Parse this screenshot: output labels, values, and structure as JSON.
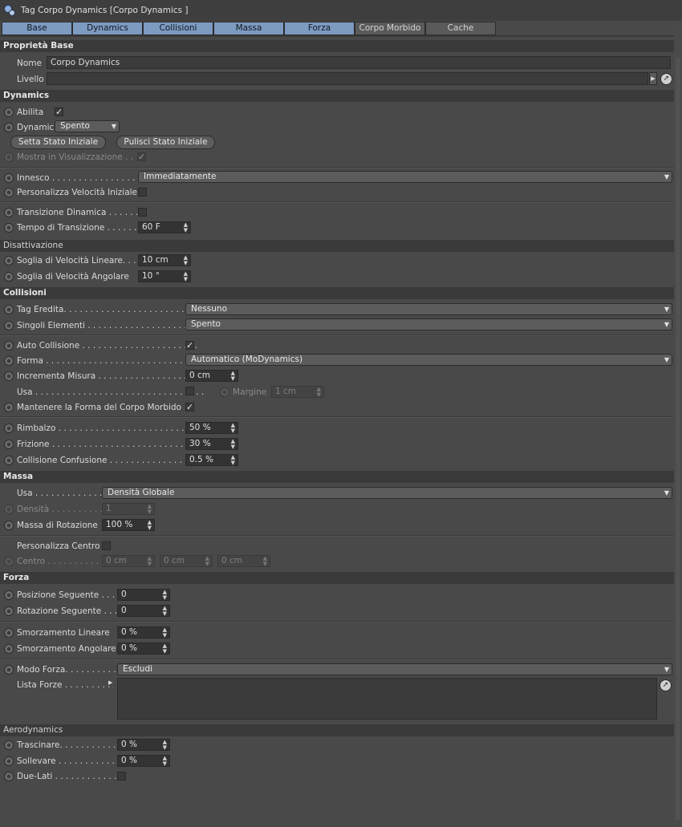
{
  "window": {
    "title": "Tag Corpo Dynamics [Corpo Dynamics ]"
  },
  "tabs": [
    {
      "label": "Base",
      "active": true
    },
    {
      "label": "Dynamics",
      "active": true
    },
    {
      "label": "Collisioni",
      "active": true
    },
    {
      "label": "Massa",
      "active": true
    },
    {
      "label": "Forza",
      "active": true
    },
    {
      "label": "Corpo Morbido",
      "active": false
    },
    {
      "label": "Cache",
      "active": false
    }
  ],
  "base": {
    "header": "Proprietà Base",
    "name_label": "Nome",
    "name_value": "Corpo Dynamics",
    "layer_label": "Livello",
    "layer_value": ""
  },
  "dynamics": {
    "header": "Dynamics",
    "enable_label": "Abilita",
    "enable_checked": "✓",
    "dynamic_label": "Dynamic",
    "dynamic_value": "Spento",
    "set_initial_button": "Setta Stato Iniziale",
    "clear_initial_button": "Pulisci Stato Iniziale",
    "show_in_view_label": "Mostra in Visualizzazione . .",
    "show_in_view_checked": "✓",
    "trigger_label": "Innesco . . . . . . . . . . . . . . . . . . .",
    "trigger_value": "Immediatamente",
    "custom_velocity_label": "Personalizza Velocità Iniziale",
    "dynamic_transition_label": "Transizione Dinamica . . . . . .",
    "transition_time_label": "Tempo di Transizione . . . . . .",
    "transition_time_value": "60 F"
  },
  "deactivation": {
    "header": "Disattivazione",
    "linear_threshold_label": "Soglia di Velocità Lineare. . .",
    "linear_threshold_value": "10 cm",
    "angular_threshold_label": "Soglia di Velocità Angolare",
    "angular_threshold_value": "10 °"
  },
  "collisions": {
    "header": "Collisioni",
    "inherit_tag_label": "Tag Eredita. . . . . . . . . . . . . . . . . . . . . . . . . .",
    "inherit_tag_value": "Nessuno",
    "individual_elements_label": "Singoli Elementi . . . . . . . . . . . . . . . . . . . . .",
    "individual_elements_value": "Spento",
    "self_collision_label": "Auto Collisione . . . . . . . . . . . . . . . . . . . . . .",
    "self_collision_checked": "✓",
    "shape_label": "Forma . . . . . . . . . . . . . . . . . . . . . . . . . . . . .",
    "shape_value": "Automatico (MoDynamics)",
    "size_increment_label": "Incrementa Misura . . . . . . . . . . . . . . . . . . .",
    "size_increment_value": "0 cm",
    "use_label": "Usa . . . . . . . . . . . . . . . . . . . . . . . . . . . . . . . .",
    "margin_label": "Margine",
    "margin_value": "1 cm",
    "keep_soft_shape_label": "Mantenere la Forma del Corpo Morbido",
    "keep_soft_shape_checked": "✓",
    "bounce_label": "Rimbalzo . . . . . . . . . . . . . . . . . . . . . . . . . . .",
    "bounce_value": "50 %",
    "friction_label": "Frizione . . . . . . . . . . . . . . . . . . . . . . . . . . . .",
    "friction_value": "30 %",
    "collision_noise_label": "Collisione Confusione . . . . . . . . . . . . . . . .",
    "collision_noise_value": "0.5 %"
  },
  "mass": {
    "header": "Massa",
    "use_label": "Usa . . . . . . . . . . . . . . .",
    "use_value": "Densità Globale",
    "density_label": "Densità . . . . . . . . . . .",
    "density_value": "1",
    "rotational_mass_label": "Massa di Rotazione",
    "rotational_mass_value": "100 %",
    "custom_center_label": "Personalizza Centro",
    "center_label": "Centro . . . . . . . . . . . .",
    "center_x": "0 cm",
    "center_y": "0 cm",
    "center_z": "0 cm"
  },
  "force": {
    "header": "Forza",
    "follow_position_label": "Posizione Seguente . . .",
    "follow_position_value": "0",
    "follow_rotation_label": "Rotazione Seguente . . .",
    "follow_rotation_value": "0",
    "linear_damping_label": "Smorzamento Lineare",
    "linear_damping_value": "0 %",
    "angular_damping_label": "Smorzamento Angolare",
    "angular_damping_value": "0 %",
    "force_mode_label": "Modo Forza. . . . . . . . . .",
    "force_mode_value": "Escludi",
    "force_list_label": "Lista Forze . . . . . . . . ."
  },
  "aerodynamics": {
    "header": "Aerodynamics",
    "drag_label": "Trascinare. . . . . . . . . . . .",
    "drag_value": "0 %",
    "lift_label": "Sollevare . . . . . . . . . . . .",
    "lift_value": "0 %",
    "two_sided_label": "Due-Lati . . . . . . . . . . . . ."
  },
  "colors": {
    "background": "#494949",
    "section_header": "#3a3a3a",
    "active_tab": "#7d9ac0"
  }
}
